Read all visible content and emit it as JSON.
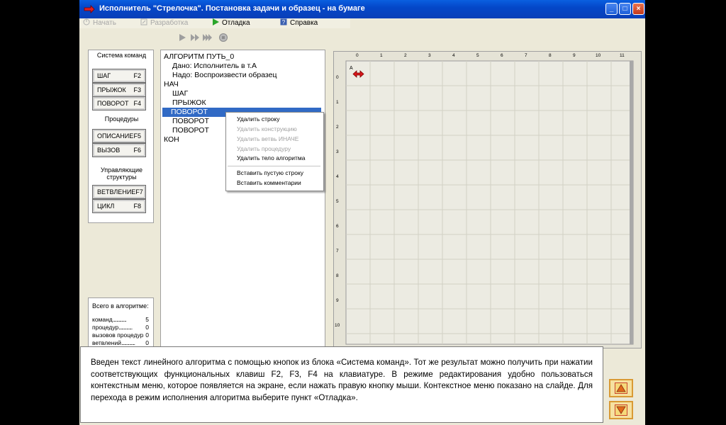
{
  "window": {
    "title": "Исполнитель \"Стрелочка\". Постановка задачи и образец - на бумаге",
    "minimize_label": "_",
    "maximize_label": "□",
    "close_label": "×"
  },
  "menu": {
    "start": "Начать",
    "develop": "Разработка",
    "debug": "Отладка",
    "help": "Справка"
  },
  "toolbar_icons": [
    "play-icon",
    "step-icon",
    "fast-forward-icon",
    "stop-icon"
  ],
  "sidebar": {
    "commands_title": "Система команд",
    "commands": [
      {
        "label": "ШАГ",
        "key": "F2"
      },
      {
        "label": "ПРЫЖОК",
        "key": "F3"
      },
      {
        "label": "ПОВОРОТ",
        "key": "F4"
      }
    ],
    "procedures_title": "Процедуры",
    "procedures": [
      {
        "label": "ОПИСАНИЕ",
        "key": "F5"
      },
      {
        "label": "ВЫЗОВ",
        "key": "F6"
      }
    ],
    "structures_title": "Управляющие структуры",
    "structures": [
      {
        "label": "ВЕТВЛЕНИЕ",
        "key": "F7"
      },
      {
        "label": "ЦИКЛ",
        "key": "F8"
      }
    ]
  },
  "stats": {
    "title": "Всего в алгоритме:",
    "rows": [
      {
        "label": "команд",
        "dots": "..............",
        "value": "5"
      },
      {
        "label": "процедур",
        "dots": "..............",
        "value": "0"
      },
      {
        "label": "вызовов процедур",
        "dots": "",
        "value": "0"
      },
      {
        "label": "ветвлений",
        "dots": "..............",
        "value": "0"
      }
    ]
  },
  "code": {
    "lines": [
      "АЛГОРИТМ ПУТЬ_0",
      "Дано: Исполнитель в т.А",
      "Надо: Воспроизвести образец",
      "НАЧ",
      "ШАГ",
      "ПРЫЖОК",
      "ПОВОРОТ",
      "ПОВОРОТ",
      "ПОВОРОТ",
      "КОН"
    ],
    "selected_line": 6
  },
  "context_menu": {
    "items": [
      {
        "label": "Удалить строку",
        "enabled": true
      },
      {
        "label": "Удалить конструкцию",
        "enabled": false
      },
      {
        "label": "Удалить ветвь ИНАЧЕ",
        "enabled": false
      },
      {
        "label": "Удалить процедуру",
        "enabled": false
      },
      {
        "label": "Удалить тело алгоритма",
        "enabled": true
      },
      {
        "label": "Вставить пустую строку",
        "enabled": true
      },
      {
        "label": "Вставить комментарии",
        "enabled": true
      }
    ]
  },
  "field": {
    "x_ticks": [
      "0",
      "1",
      "2",
      "3",
      "4",
      "5",
      "6",
      "7",
      "8",
      "9",
      "10",
      "11"
    ],
    "y_ticks": [
      "0",
      "1",
      "2",
      "3",
      "4",
      "5",
      "6",
      "7",
      "8",
      "9",
      "10"
    ],
    "point_label": "A",
    "arrow_color": "#d8161a"
  },
  "note": {
    "text": "Введен текст линейного алгоритма с помощью кнопок из блока «Система команд». Тот же результат можно получить при нажатии соответствующих функциональных клавиш F2, F3, F4 на клавиатуре. В режиме редактирования удобно пользоваться контекстным меню, которое появляется на экране, если нажать правую кнопку мыши. Контекстное меню показано на слайде. Для перехода в режим исполнения алгоритма выберите пункт «Отладка»."
  },
  "nav": {
    "up_icon": "triangle-up-icon",
    "down_icon": "triangle-down-icon"
  }
}
